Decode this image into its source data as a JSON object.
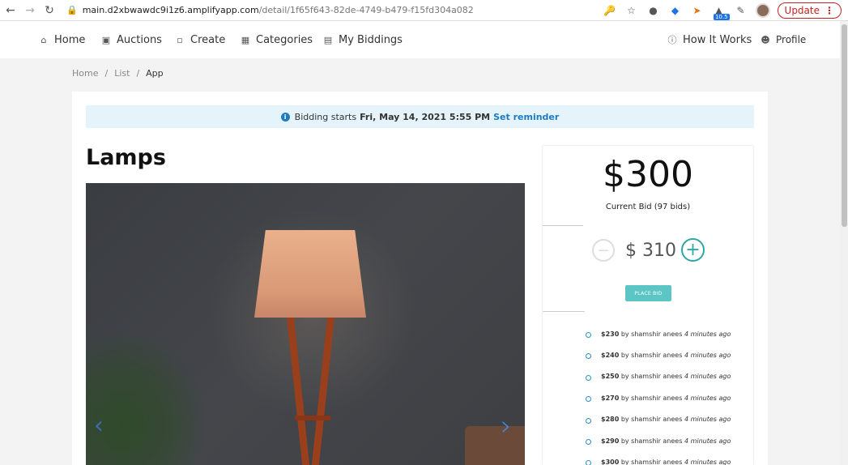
{
  "browser": {
    "url_host": "main.d2xbwawdc9i1z6.amplifyapp.com",
    "url_path": "/detail/1f65f643-82de-4749-b479-f15fd304a082",
    "update_label": "Update",
    "badge": "10.5"
  },
  "nav": {
    "home": "Home",
    "auctions": "Auctions",
    "create": "Create",
    "categories": "Categories",
    "my_biddings": "My Biddings",
    "how_it_works": "How It Works",
    "profile": "Profile"
  },
  "breadcrumb": {
    "home": "Home",
    "list": "List",
    "current": "App",
    "separator": "/"
  },
  "notice": {
    "prefix": "Bidding starts",
    "date": "Fri, May 14, 2021 5:55 PM",
    "reminder": "Set reminder"
  },
  "item": {
    "title": "Lamps"
  },
  "bid": {
    "current_price": "$300",
    "current_label": "Current Bid (97 bids)",
    "next_amount": "$ 310",
    "place_label": "PLACE BID"
  },
  "history": [
    {
      "amount": "$230",
      "by": "by shamshir anees",
      "ago": "4 minutes ago"
    },
    {
      "amount": "$240",
      "by": "by shamshir anees",
      "ago": "4 minutes ago"
    },
    {
      "amount": "$250",
      "by": "by shamshir anees",
      "ago": "4 minutes ago"
    },
    {
      "amount": "$270",
      "by": "by shamshir anees",
      "ago": "4 minutes ago"
    },
    {
      "amount": "$280",
      "by": "by shamshir anees",
      "ago": "4 minutes ago"
    },
    {
      "amount": "$290",
      "by": "by shamshir anees",
      "ago": "4 minutes ago"
    },
    {
      "amount": "$300",
      "by": "by shamshir anees",
      "ago": "4 minutes ago"
    }
  ],
  "colors": {
    "accent": "#1f7bc1",
    "teal": "#2fa8a8",
    "notice_bg": "#e4f4fa",
    "update_red": "#c5221f"
  }
}
